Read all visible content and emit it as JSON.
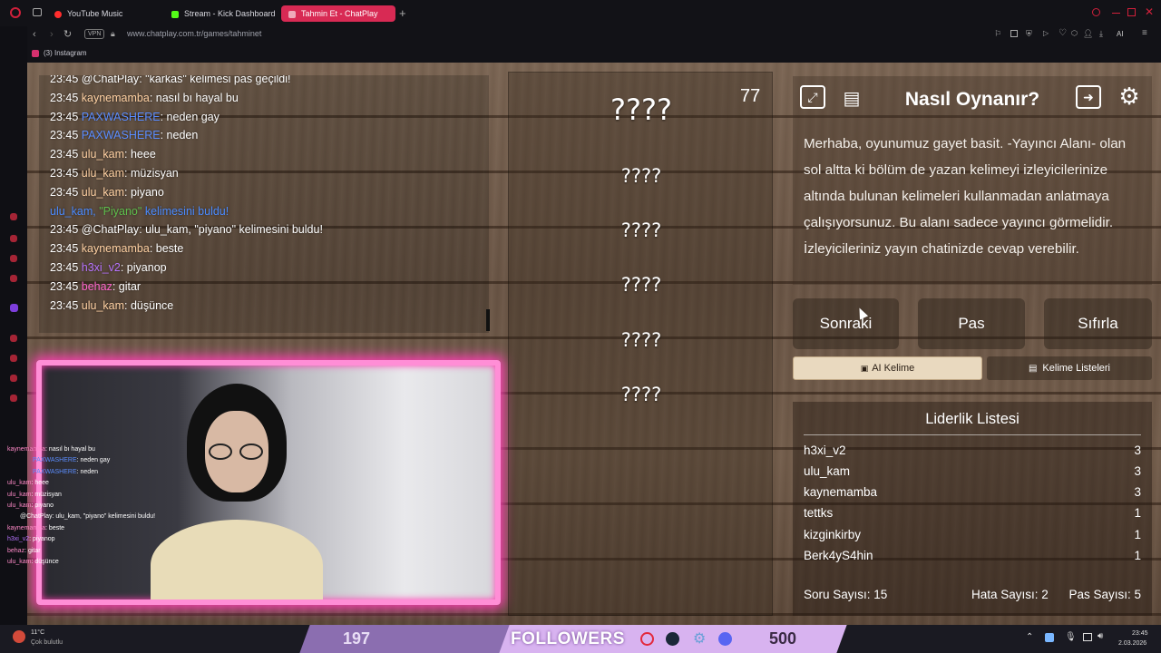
{
  "browser": {
    "tabs": [
      {
        "label": "YouTube Music",
        "color": "#ff2d2d"
      },
      {
        "label": "Stream - Kick Dashboard",
        "color": "#53fc18"
      },
      {
        "label": "Tahmin Et - ChatPlay",
        "color": "#d82a54",
        "active": true
      }
    ],
    "vpn_label": "VPN",
    "url": "www.chatplay.com.tr/games/tahminet",
    "bookmark": "(3) Instagram",
    "ai_label": "AI"
  },
  "chat": {
    "lines": [
      {
        "time": "23:45",
        "user": "@ChatPlay",
        "text": ": \"karkas\" kelimesi pas geçildi!",
        "style": "plain"
      },
      {
        "time": "23:45",
        "user": "kaynemamba",
        "text": ": nasıl bı hayal bu",
        "style": "u"
      },
      {
        "time": "23:45",
        "user": "PAXWASHERE",
        "text": ": neden gay",
        "style": "blue"
      },
      {
        "time": "23:45",
        "user": "PAXWASHERE",
        "text": ": neden",
        "style": "blue"
      },
      {
        "time": "23:45",
        "user": "ulu_kam",
        "text": ": heee",
        "style": "u"
      },
      {
        "time": "23:45",
        "user": "ulu_kam",
        "text": ": müzisyan",
        "style": "u"
      },
      {
        "time": "23:45",
        "user": "ulu_kam",
        "text": ": piyano",
        "style": "u"
      },
      {
        "time": "",
        "user": "ulu_kam,",
        "text": "\"Piyano\"",
        "extra": "kelimesini buldu!",
        "style": "system"
      },
      {
        "time": "23:45",
        "user": "@ChatPlay",
        "text": ": ulu_kam, \"piyano\" kelimesini buldu!",
        "style": "plain"
      },
      {
        "time": "23:45",
        "user": "kaynemamba",
        "text": ": beste",
        "style": "u"
      },
      {
        "time": "23:45",
        "user": "h3xi_v2",
        "text": ": piyanop",
        "style": "purple"
      },
      {
        "time": "23:45",
        "user": "behaz",
        "text": ": gitar",
        "style": "pink"
      },
      {
        "time": "23:45",
        "user": "ulu_kam",
        "text": ": düşünce",
        "style": "u"
      }
    ]
  },
  "cam_chat": {
    "lines": [
      {
        "user": "kaynemamba",
        "text": ": nasıl bı hayal bu"
      },
      {
        "user": "PAXWASHERE",
        "text": ": neden gay"
      },
      {
        "user": "PAXWASHERE",
        "text": ": neden"
      },
      {
        "user": "ulu_kam",
        "text": ": heee"
      },
      {
        "user": "ulu_kam",
        "text": ": müzisyan"
      },
      {
        "user": "ulu_kam",
        "text": ": piyano"
      },
      {
        "user": "@ChatPlay",
        "text": ": ulu_kam, \"piyano\" kelimesini buldu!"
      },
      {
        "user": "kaynemamba",
        "text": ": beste"
      },
      {
        "user": "h3xi_v2",
        "text": ": piyanop"
      },
      {
        "user": "behaz",
        "text": ": gitar"
      },
      {
        "user": "ulu_kam",
        "text": ": düşünce"
      }
    ]
  },
  "game": {
    "timer": "77",
    "answers": [
      "????",
      "????",
      "????",
      "????",
      "????",
      "????"
    ],
    "howto_title": "Nasıl Oynanır?",
    "howto_text": "Merhaba, oyunumuz gayet basit. -Yayıncı Alanı- olan sol altta ki bölüm de yazan kelimeyi izleyicilerinize altında bulunan kelimeleri kullanmadan anlatmaya çalışıyorsunuz. Bu alanı sadece yayıncı görmelidir. İzleyicileriniz yayın chatinizde cevap verebilir.",
    "buttons": {
      "next": "Sonraki",
      "pass": "Pas",
      "reset": "Sıfırla"
    },
    "ai_word": "AI Kelime",
    "word_lists": "Kelime Listeleri"
  },
  "leaderboard": {
    "title": "Liderlik Listesi",
    "rows": [
      {
        "name": "h3xi_v2",
        "score": "3"
      },
      {
        "name": "ulu_kam",
        "score": "3"
      },
      {
        "name": "kaynemamba",
        "score": "3"
      },
      {
        "name": "tettks",
        "score": "1"
      },
      {
        "name": "kizginkirby",
        "score": "1"
      },
      {
        "name": "Berk4yS4hin",
        "score": "1"
      }
    ],
    "stats": {
      "questions": "Soru Sayısı: 15",
      "errors": "Hata Sayısı: 2",
      "passes": "Pas Sayısı: 5"
    }
  },
  "overlay": {
    "count": "197",
    "label": "FOLLOWERS",
    "goal": "500"
  },
  "taskbar": {
    "weather_temp": "11°C",
    "weather_desc": "Çok bulutlu",
    "time": "23:45",
    "date": "2.03.2026"
  }
}
